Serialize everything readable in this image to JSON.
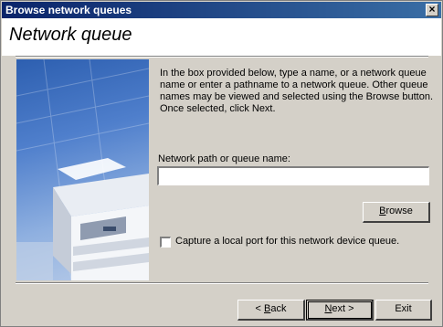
{
  "window": {
    "title": "Browse network queues",
    "close_label": "×"
  },
  "header": {
    "title": "Network queue"
  },
  "description": "In the box provided below, type a name, or a network queue name or enter a pathname to a network queue. Other queue names may be viewed and selected using the Browse button. Once selected, click Next.",
  "path_field": {
    "label": "Network path or queue name:",
    "value": "",
    "placeholder": ""
  },
  "browse_button": {
    "label_pre": "",
    "label_ul": "B",
    "label_post": "rowse"
  },
  "capture_checkbox": {
    "checked": false,
    "label": "Capture a local port for this network device queue."
  },
  "footer": {
    "back": {
      "pre": "< ",
      "ul": "B",
      "post": "ack"
    },
    "next": {
      "pre": "",
      "ul": "N",
      "post": "ext >"
    },
    "exit": "Exit"
  },
  "colors": {
    "titlebar": "#0a246a",
    "dialog_bg": "#d4d0c8",
    "art_blue": "#2d5fb0"
  }
}
